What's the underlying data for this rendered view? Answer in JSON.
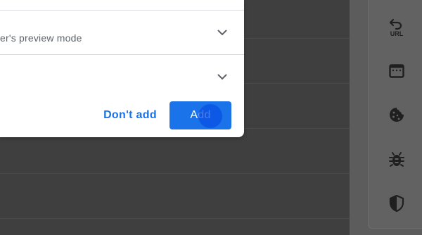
{
  "dialog": {
    "row1_text": "er's preview mode",
    "dont_add_label": "Don't add",
    "add_label": "Add"
  },
  "toolbar": {
    "url_icon_text": "URL",
    "icons": [
      "undo-url-icon",
      "window-icon",
      "cookie-icon",
      "bug-icon",
      "shield-icon"
    ]
  },
  "colors": {
    "accent": "#1a73e8",
    "backdrop": "#3f3f3f",
    "panel": "#5c5c5c"
  }
}
